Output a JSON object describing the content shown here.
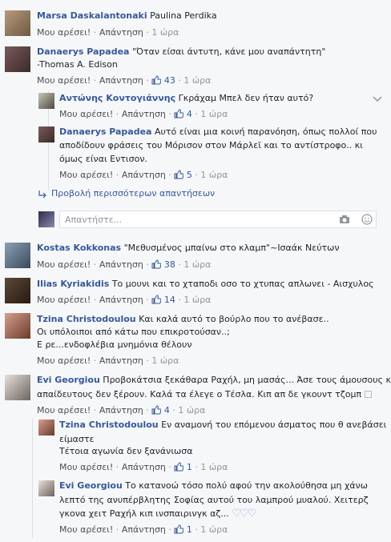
{
  "comments": [
    {
      "name": "Marsa Daskalantonaki",
      "text": " Paulina Perdika",
      "like": "Μου αρέσει!",
      "reply": "Απάντηση",
      "count": "",
      "time": "1 ώρα"
    },
    {
      "name": "Danaerys Papadea",
      "text": " \"Όταν είσαι άντυτη, κάνε μου αναπάντητη\"",
      "text2": "-Thomas A. Edison",
      "like": "Μου αρέσει!",
      "reply": "Απάντηση",
      "count": "43",
      "time": "1 ώρα"
    },
    {
      "name": "Αντώνης Κοντογιάννης",
      "text": " Γκράχαμ Μπελ δεν ήταν αυτό?",
      "like": "Μου αρέσει!",
      "reply": "Απάντηση",
      "count": "4",
      "time": "1 ώρα"
    },
    {
      "name": "Danaerys Papadea",
      "text": " Αυτό είναι μια κοινή παρανόηση, όπως πολλοί που",
      "text2": "αποδίδουν φράσεις του Μόρισον στον Μάρλεϊ και το αντίστροφο.. κι",
      "text3": "όμως είναι Εντισον.",
      "like": "Μου αρέσει!",
      "reply": "Απάντηση",
      "count": "5",
      "time": "1 ώρα"
    },
    {
      "name": "Kostas Kokkonas",
      "text": " \"Μεθυσμένος μπαίνω στο κλαμπ\"~Ισαάκ Νεύτων",
      "like": "Μου αρέσει!",
      "reply": "Απάντηση",
      "count": "38",
      "time": "1 ώρα"
    },
    {
      "name": "Ilias Kyriakidis",
      "text": " Το μουνι και το χταποδι οσο το χτυπας απλωνει - Αισχυλος",
      "like": "Μου αρέσει!",
      "reply": "Απάντηση",
      "count": "14",
      "time": "1 ώρα"
    },
    {
      "name": "Tzina Christodoulou",
      "text": " Και καλά αυτό το βούρλο που το ανέβασε..",
      "text2": "Οι υπόλοιποι από κάτω που επικροτούσαν..;",
      "text3": "Ε ρε...ενδοφλέβια μνημόνια θέλουν",
      "like": "Μου αρέσει!",
      "reply": "Απάντηση",
      "count": "",
      "time": "1 ώρα"
    },
    {
      "name": "Evi Georgiou",
      "text": " Προβοκάτσια ξεκάθαρα Ραχήλ, μη μασάς... Άσε τους άμουσους και",
      "text2": "απαίδευτους δεν ξέρουν. Καλά τα έλεγε ο Τέσλα. Κιπ απ δε γκουντ τζομπ",
      "like": "Μου αρέσει!",
      "reply": "Απάντηση",
      "count": "4",
      "time": "1 ώρα"
    },
    {
      "name": "Tzina Christodoulou",
      "text": " Εν αναμονή του επόμενου άσματος που θ ανεβάσει",
      "text2": "είμαστε",
      "text3": "Τέτοια αγωνία δεν ξανάνιωσα",
      "like": "Μου αρέσει!",
      "reply": "Απάντηση",
      "count": "1",
      "time": "1 ώρα"
    },
    {
      "name": "Evi Georgiou",
      "text": " Το κατανοώ τόσο πολύ αφού την ακολούθησα μη χάνω",
      "text2": "λεπτό της ανυπέρβλητης Σοφίας αυτού του λαμπρού μυαλού. Χειτερζ",
      "text3": "γκονα χειτ Ραχήλ κιπ ινσπαιρινγκ αζ...",
      "like": "Μου αρέσει!",
      "reply": "Απάντηση",
      "count": "1",
      "time": "1 ώρα"
    }
  ],
  "more_replies": "Προβολή περισσότερων απαντήσεων",
  "reply_placeholder": "Απαντήστε...",
  "dot": " · ",
  "colors": {
    "link": "#365899",
    "meta": "#90949c",
    "bg": "#f6f7f9"
  }
}
